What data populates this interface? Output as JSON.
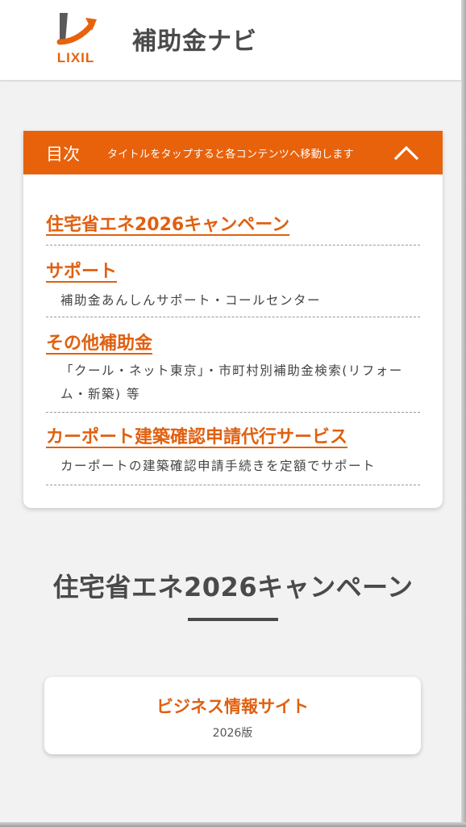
{
  "colors": {
    "accent": "#e8620c",
    "text_dark": "#4a4a4a",
    "background": "#f2f2f2"
  },
  "header": {
    "logo_text": "LIXIL",
    "title": "補助金ナビ"
  },
  "toc": {
    "title": "目次",
    "hint": "タイトルをタップすると各コンテンツへ移動します",
    "toggle_icon": "chevron-up-icon",
    "items": [
      {
        "label": "住宅省エネ2026キャンペーン",
        "desc": ""
      },
      {
        "label": "サポート",
        "desc": "補助金あんしんサポート・コールセンター"
      },
      {
        "label": "その他補助金",
        "desc": "「クール・ネット東京」・市町村別補助金検索(リフォーム・新築) 等"
      },
      {
        "label": "カーポート建築確認申請代行サービス",
        "desc": "カーポートの建築確認申請手続きを定額でサポート"
      }
    ]
  },
  "section": {
    "title": "住宅省エネ2026キャンペーン"
  },
  "card": {
    "title": "ビジネス情報サイト",
    "subtitle": "2026版"
  }
}
